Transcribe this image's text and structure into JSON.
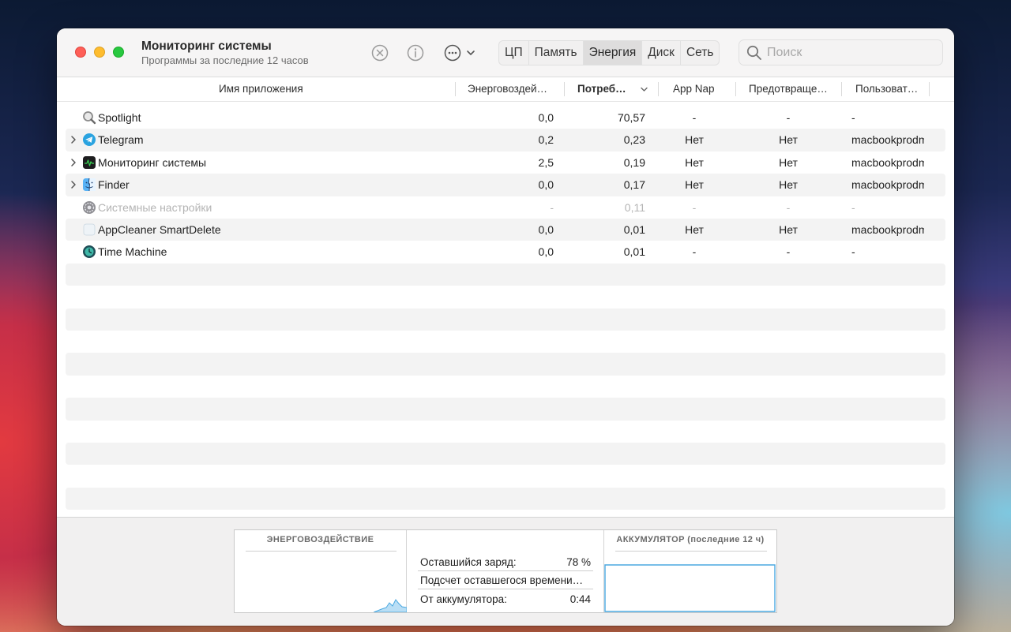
{
  "window": {
    "title": "Мониторинг системы",
    "subtitle": "Программы за последние 12 часов"
  },
  "toolbar": {
    "stop_icon": "xmark-circle-icon",
    "info_icon": "info-circle-icon",
    "more_icon": "ellipsis-circle-icon",
    "tabs": [
      {
        "label": "ЦП",
        "active": false
      },
      {
        "label": "Память",
        "active": false
      },
      {
        "label": "Энергия",
        "active": true
      },
      {
        "label": "Диск",
        "active": false
      },
      {
        "label": "Сеть",
        "active": false
      }
    ],
    "search_placeholder": "Поиск"
  },
  "columns": {
    "app_name": "Имя приложения",
    "energy_impact": "Энерговоздей…",
    "consumption": "Потреб…",
    "app_nap": "App Nap",
    "preventing_sleep": "Предотвраще…",
    "user": "Пользоват…",
    "sort_column": "consumption",
    "sort_direction": "descending"
  },
  "rows": [
    {
      "name": "Spotlight",
      "icon": "spotlight-icon",
      "expandable": false,
      "dim": false,
      "energy": "0,0",
      "consumption": "70,57",
      "app_nap": "-",
      "preventing": "-",
      "user": "-"
    },
    {
      "name": "Telegram",
      "icon": "telegram-icon",
      "expandable": true,
      "dim": false,
      "energy": "0,2",
      "consumption": "0,23",
      "app_nap": "Нет",
      "preventing": "Нет",
      "user": "macbookprodm"
    },
    {
      "name": "Мониторинг системы",
      "icon": "activity-monitor-icon",
      "expandable": true,
      "dim": false,
      "energy": "2,5",
      "consumption": "0,19",
      "app_nap": "Нет",
      "preventing": "Нет",
      "user": "macbookprodm"
    },
    {
      "name": "Finder",
      "icon": "finder-icon",
      "expandable": true,
      "dim": false,
      "energy": "0,0",
      "consumption": "0,17",
      "app_nap": "Нет",
      "preventing": "Нет",
      "user": "macbookprodm"
    },
    {
      "name": "Системные настройки",
      "icon": "system-settings-icon",
      "expandable": false,
      "dim": true,
      "energy": "-",
      "consumption": "0,11",
      "app_nap": "-",
      "preventing": "-",
      "user": "-"
    },
    {
      "name": "AppCleaner SmartDelete",
      "icon": "appcleaner-icon",
      "expandable": false,
      "dim": false,
      "energy": "0,0",
      "consumption": "0,01",
      "app_nap": "Нет",
      "preventing": "Нет",
      "user": "macbookprodm"
    },
    {
      "name": "Time Machine",
      "icon": "time-machine-icon",
      "expandable": false,
      "dim": false,
      "energy": "0,0",
      "consumption": "0,01",
      "app_nap": "-",
      "preventing": "-",
      "user": "-"
    }
  ],
  "bottom": {
    "energy_impact_title": "ЭНЕРГОВОЗДЕЙСТВИЕ",
    "battery_title": "АККУМУЛЯТОР (последние 12 ч)",
    "stats": [
      {
        "label": "Оставшийся заряд:",
        "value": "78 %"
      },
      {
        "label": "Подсчет оставшегося времени…",
        "value": ""
      },
      {
        "label": "От аккумулятора:",
        "value": "0:44"
      }
    ]
  },
  "colors": {
    "graph_line": "#4aa8e0",
    "graph_fill": "#b9def5"
  }
}
